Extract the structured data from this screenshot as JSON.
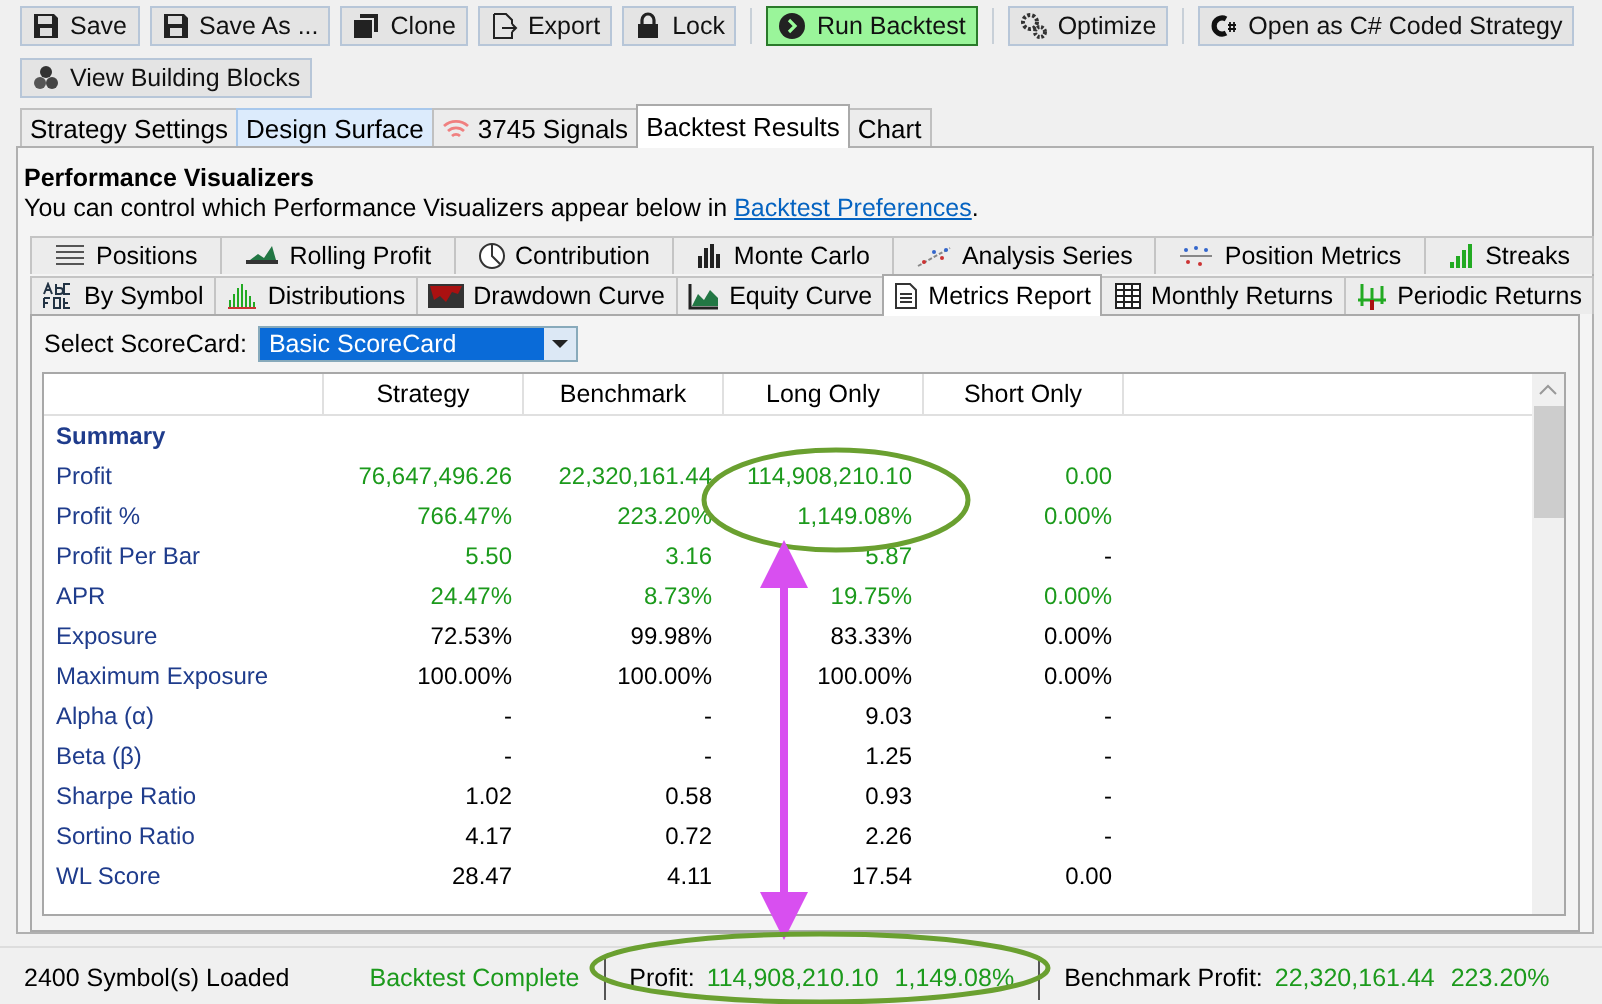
{
  "toolbar": [
    {
      "label": "Save",
      "kind": "normal"
    },
    {
      "label": "Save As ...",
      "kind": "normal"
    },
    {
      "label": "Clone",
      "kind": "normal"
    },
    {
      "label": "Export",
      "kind": "normal"
    },
    {
      "label": "Lock",
      "kind": "normal"
    },
    {
      "label": "Run Backtest",
      "kind": "primary"
    },
    {
      "label": "Optimize",
      "kind": "normal"
    },
    {
      "label": "Open as C# Coded Strategy",
      "kind": "normal"
    }
  ],
  "toolbar_2": [
    {
      "label": "View Building Blocks"
    }
  ],
  "tabs": [
    {
      "label": "Strategy Settings",
      "selected": false,
      "highlighted": false
    },
    {
      "label": "Design Surface",
      "selected": false,
      "highlighted": true
    },
    {
      "label": "3745 Signals",
      "selected": false,
      "highlighted": false
    },
    {
      "label": "Backtest Results",
      "selected": true,
      "highlighted": false
    },
    {
      "label": "Chart",
      "selected": false,
      "highlighted": false
    }
  ],
  "panel": {
    "title": "Performance Visualizers",
    "description": "You can control which Performance Visualizers appear below in ",
    "link": "Backtest Preferences",
    "after_link": "."
  },
  "visualizer_tabs_top": [
    {
      "label": "Positions",
      "selected": false
    },
    {
      "label": "Rolling Profit",
      "selected": false
    },
    {
      "label": "Contribution",
      "selected": false
    },
    {
      "label": "Monte Carlo",
      "selected": false
    },
    {
      "label": "Analysis Series",
      "selected": false
    },
    {
      "label": "Position Metrics",
      "selected": false
    },
    {
      "label": "Streaks",
      "selected": false
    }
  ],
  "visualizer_tabs_bottom": [
    {
      "label": "By Symbol",
      "selected": false
    },
    {
      "label": "Distributions",
      "selected": false
    },
    {
      "label": "Drawdown Curve",
      "selected": false
    },
    {
      "label": "Equity Curve",
      "selected": false
    },
    {
      "label": "Metrics Report",
      "selected": true
    },
    {
      "label": "Monthly Returns",
      "selected": false
    },
    {
      "label": "Periodic Returns",
      "selected": false
    }
  ],
  "scorecard": {
    "label": "Select ScoreCard:",
    "value": "Basic ScoreCard"
  },
  "table": {
    "columns": [
      "Strategy",
      "Benchmark",
      "Long Only",
      "Short Only"
    ],
    "section": "Summary",
    "rows": [
      {
        "label": "Profit",
        "cells": [
          {
            "text": "76,647,496.26",
            "kind": "gain"
          },
          {
            "text": "22,320,161.44",
            "kind": "gain"
          },
          {
            "text": "114,908,210.10",
            "kind": "gain"
          },
          {
            "text": "0.00",
            "kind": "gain"
          }
        ]
      },
      {
        "label": "Profit %",
        "cells": [
          {
            "text": "766.47%",
            "kind": "gain"
          },
          {
            "text": "223.20%",
            "kind": "gain"
          },
          {
            "text": "1,149.08%",
            "kind": "gain"
          },
          {
            "text": "0.00%",
            "kind": "gain"
          }
        ]
      },
      {
        "label": "Profit Per Bar",
        "cells": [
          {
            "text": "5.50",
            "kind": "gain"
          },
          {
            "text": "3.16",
            "kind": "gain"
          },
          {
            "text": "5.87",
            "kind": "gain"
          },
          {
            "text": "-",
            "kind": "plain"
          }
        ]
      },
      {
        "label": "APR",
        "cells": [
          {
            "text": "24.47%",
            "kind": "gain"
          },
          {
            "text": "8.73%",
            "kind": "gain"
          },
          {
            "text": "19.75%",
            "kind": "gain"
          },
          {
            "text": "0.00%",
            "kind": "gain"
          }
        ]
      },
      {
        "label": "Exposure",
        "cells": [
          {
            "text": "72.53%",
            "kind": "plain"
          },
          {
            "text": "99.98%",
            "kind": "plain"
          },
          {
            "text": "83.33%",
            "kind": "plain"
          },
          {
            "text": "0.00%",
            "kind": "plain"
          }
        ]
      },
      {
        "label": "Maximum Exposure",
        "cells": [
          {
            "text": "100.00%",
            "kind": "plain"
          },
          {
            "text": "100.00%",
            "kind": "plain"
          },
          {
            "text": "100.00%",
            "kind": "plain"
          },
          {
            "text": "0.00%",
            "kind": "plain"
          }
        ]
      },
      {
        "label": "Alpha (α)",
        "cells": [
          {
            "text": "-",
            "kind": "plain"
          },
          {
            "text": "-",
            "kind": "plain"
          },
          {
            "text": "9.03",
            "kind": "plain"
          },
          {
            "text": "-",
            "kind": "plain"
          }
        ]
      },
      {
        "label": "Beta (β)",
        "cells": [
          {
            "text": "-",
            "kind": "plain"
          },
          {
            "text": "-",
            "kind": "plain"
          },
          {
            "text": "1.25",
            "kind": "plain"
          },
          {
            "text": "-",
            "kind": "plain"
          }
        ]
      },
      {
        "label": "Sharpe Ratio",
        "cells": [
          {
            "text": "1.02",
            "kind": "plain"
          },
          {
            "text": "0.58",
            "kind": "plain"
          },
          {
            "text": "0.93",
            "kind": "plain"
          },
          {
            "text": "-",
            "kind": "plain"
          }
        ]
      },
      {
        "label": "Sortino Ratio",
        "cells": [
          {
            "text": "4.17",
            "kind": "plain"
          },
          {
            "text": "0.72",
            "kind": "plain"
          },
          {
            "text": "2.26",
            "kind": "plain"
          },
          {
            "text": "-",
            "kind": "plain"
          }
        ]
      },
      {
        "label": "WL Score",
        "cells": [
          {
            "text": "28.47",
            "kind": "plain"
          },
          {
            "text": "4.11",
            "kind": "plain"
          },
          {
            "text": "17.54",
            "kind": "plain"
          },
          {
            "text": "0.00",
            "kind": "plain"
          }
        ]
      }
    ]
  },
  "status_bar": {
    "symbols": "2400 Symbol(s) Loaded",
    "state": "Backtest Complete",
    "profit_label": "Profit:",
    "profit": "114,908,210.10",
    "profit_pct": "1,149.08%",
    "benchmark_label": "Benchmark Profit:",
    "benchmark_profit": "22,320,161.44",
    "benchmark_pct": "223.20%"
  }
}
